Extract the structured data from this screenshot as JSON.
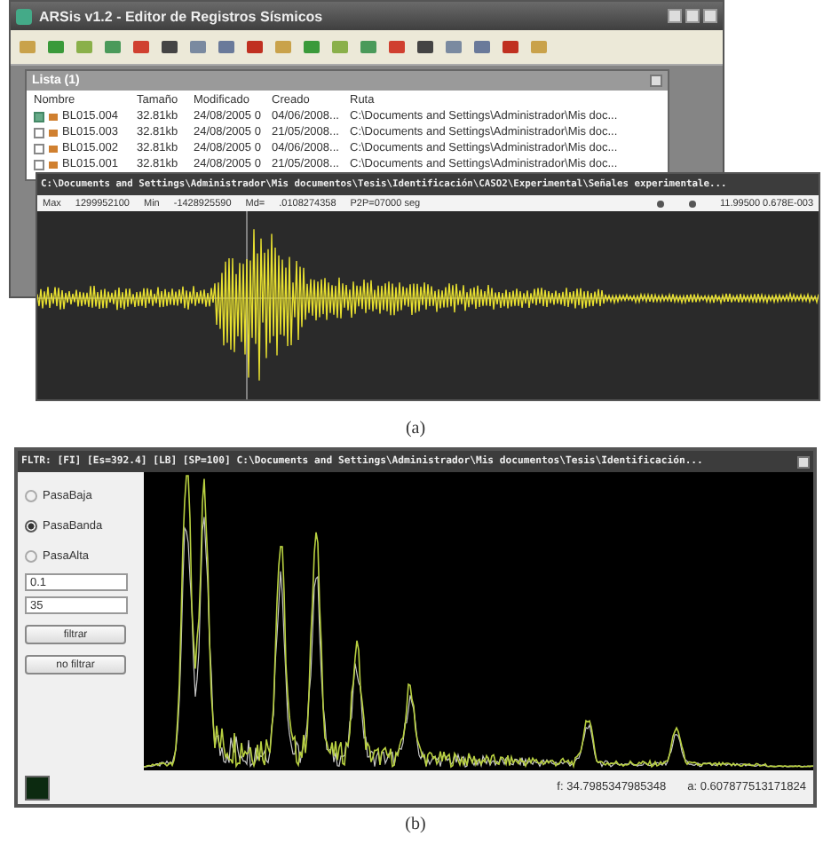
{
  "figure_a": {
    "main_window": {
      "title": "ARSis v1.2 - Editor de Registros Sísmicos"
    },
    "list_panel": {
      "title": "Lista (1)",
      "columns": [
        "Nombre",
        "Tamaño",
        "Modificado",
        "Creado",
        "Ruta"
      ],
      "rows": [
        {
          "checked": true,
          "name": "BL015.004",
          "size": "32.81kb",
          "modified": "24/08/2005 0",
          "created": "04/06/2008...",
          "path": "C:\\Documents and Settings\\Administrador\\Mis doc..."
        },
        {
          "checked": false,
          "name": "BL015.003",
          "size": "32.81kb",
          "modified": "24/08/2005 0",
          "created": "21/05/2008...",
          "path": "C:\\Documents and Settings\\Administrador\\Mis doc..."
        },
        {
          "checked": false,
          "name": "BL015.002",
          "size": "32.81kb",
          "modified": "24/08/2005 0",
          "created": "04/06/2008...",
          "path": "C:\\Documents and Settings\\Administrador\\Mis doc..."
        },
        {
          "checked": false,
          "name": "BL015.001",
          "size": "32.81kb",
          "modified": "24/08/2005 0",
          "created": "21/05/2008...",
          "path": "C:\\Documents and Settings\\Administrador\\Mis doc..."
        }
      ]
    },
    "signal_window": {
      "title": "C:\\Documents and Settings\\Administrador\\Mis documentos\\Tesis\\Identificación\\CASO2\\Experimental\\Señales experimentale...",
      "stats": [
        "Max",
        "1299952100",
        "Min",
        "-1428925590",
        "Md=",
        ".0108274358",
        "P2P=07000 seg"
      ],
      "readout": "11.99500 0.678E-003"
    },
    "caption": "(a)"
  },
  "figure_b": {
    "title": "FLTR: [FI] [Es=392.4] [LB] [SP=100] C:\\Documents and Settings\\Administrador\\Mis documentos\\Tesis\\Identificación...",
    "filters": [
      {
        "label": "PasaBaja",
        "selected": false
      },
      {
        "label": "PasaBanda",
        "selected": true
      },
      {
        "label": "PasaAlta",
        "selected": false
      }
    ],
    "inputs": [
      "0.1",
      "35"
    ],
    "buttons": [
      "filtrar",
      "no filtrar"
    ],
    "readout": [
      "f: 34.7985347985348",
      "a: 0.607877513171824"
    ],
    "caption": "(b)"
  }
}
